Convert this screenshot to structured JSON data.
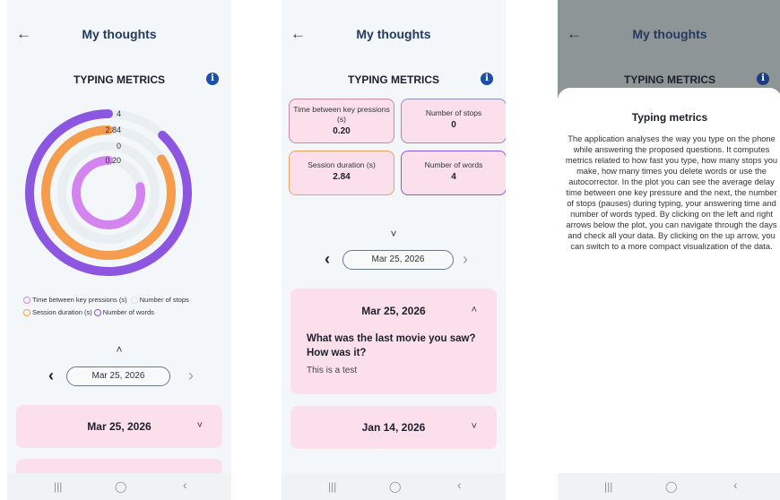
{
  "header": {
    "title": "My thoughts",
    "back_icon": "←"
  },
  "section": {
    "title": "TYPING METRICS",
    "info_icon": "i"
  },
  "chart_data": {
    "type": "radial-bar",
    "series": [
      {
        "name": "Number of words",
        "value": 4,
        "label": "4",
        "color": "#8d56e0"
      },
      {
        "name": "Session duration (s)",
        "value": 2.84,
        "label": "2.84",
        "color": "#f59d4d"
      },
      {
        "name": "Number of stops",
        "value": 0,
        "label": "0",
        "color": "#d9e4ea"
      },
      {
        "name": "Time between key pressions (s)",
        "value": 0.2,
        "label": "0.20",
        "color": "#d384ef"
      }
    ],
    "fill_fractions": [
      0.88,
      0.84,
      0,
      0.78
    ],
    "legend": [
      "Time between key pressions (s)",
      "Number of stops",
      "Session duration (s)",
      "Number of words"
    ]
  },
  "metrics": [
    {
      "label": "Time between key pressions (s)",
      "value": "0.20"
    },
    {
      "label": "Number of stops",
      "value": "0"
    },
    {
      "label": "Session duration (s)",
      "value": "2.84"
    },
    {
      "label": "Number of words",
      "value": "4"
    }
  ],
  "date_nav": {
    "date": "Mar 25, 2026",
    "prev_icon": "‹",
    "next_icon": "›",
    "up_icon": "˄",
    "down_icon": "˅"
  },
  "entries": [
    {
      "date": "Mar 25, 2026",
      "question": "What was the last movie you saw? How was it?",
      "answer": "This is a test"
    },
    {
      "date": "Jan 14, 2026"
    }
  ],
  "dialog": {
    "title": "Typing metrics",
    "body": "The application analyses the way you type on the phone while answering the proposed questions. It computes metrics related to how fast you type, how many stops you make, how many times you delete words or use the autocorrector. In the plot you can see the average delay time between one key pressure and the next, the number of stops (pauses) during typing, your answering time and number of words typed. By clicking on the left and right arrows below the plot, you can navigate through the days and check all your data. By clicking on the up arrow, you can switch to a more compact visualization of the data."
  },
  "navbar": {
    "recents": "|||",
    "home": "◯",
    "back": "‹"
  }
}
